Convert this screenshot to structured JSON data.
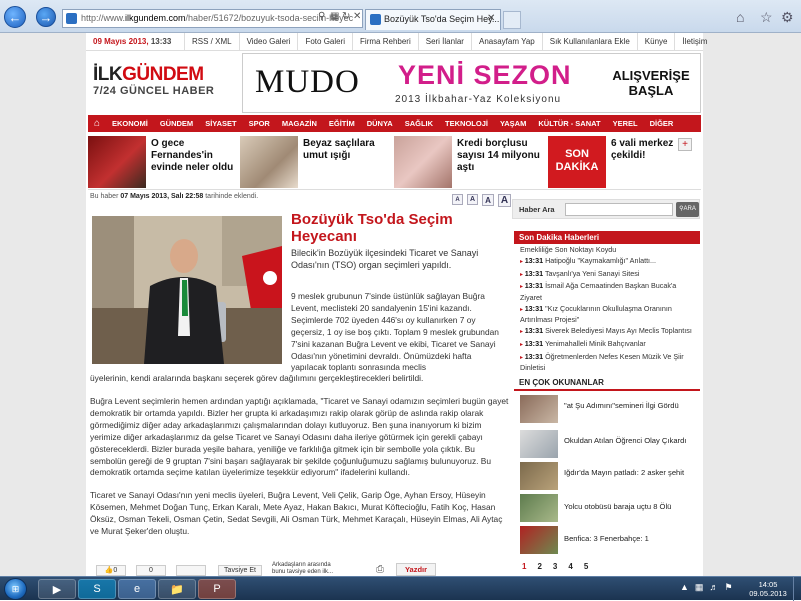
{
  "browser": {
    "url_prefix": "http://www.",
    "url_domain": "ilkgundem.com",
    "url_rest": "/haber/51672/bozuyuk-tsoda-secim-heyec",
    "tab_title": "Bozüyük Tso'da Seçim Hey...",
    "icons": {
      "back": "back-arrow-icon",
      "forward": "forward-arrow-icon",
      "home": "home-icon",
      "favorites": "star-icon",
      "tools": "gear-icon"
    }
  },
  "site": {
    "date": "09 Mayıs 2013,",
    "time": "13:33",
    "top_links": [
      "RSS / XML",
      "Video Galeri",
      "Foto Galeri",
      "Firma Rehberi",
      "Seri İlanlar",
      "Anasayfam Yap",
      "Sık Kullanılanlara Ekle",
      "Künye",
      "İletişim"
    ],
    "logo_part1": "İLK",
    "logo_part2": "GÜNDEM",
    "logo_tagline": "7/24 GÜNCEL HABER"
  },
  "banner": {
    "brand": "MUDO",
    "headline": "YENİ SEZON",
    "subline": "2013 İlkbahar-Yaz Koleksiyonu",
    "cta_line1": "ALIŞVERİŞE",
    "cta_line2": "BAŞLA"
  },
  "nav": [
    "EKONOMİ",
    "GÜNDEM",
    "SİYASET",
    "SPOR",
    "MAGAZİN",
    "EĞİTİM",
    "DÜNYA",
    "SAĞLIK",
    "TEKNOLOJİ",
    "YAŞAM",
    "KÜLTÜR - SANAT",
    "YEREL",
    "DİĞER"
  ],
  "teasers": [
    {
      "line1": "O gece",
      "line2": "Fernandes'in",
      "line3": "evinde neler oldu"
    },
    {
      "line1": "Beyaz saçlılara",
      "line2": "umut ışığı",
      "line3": ""
    },
    {
      "line1": "Kredi borçlusu",
      "line2": "sayısı 14 milyonu",
      "line3": "aştı"
    },
    {
      "line1": "6 vali merkez",
      "line2": "çekildi!",
      "line3": ""
    }
  ],
  "son_dakika_badge": {
    "line1": "SON",
    "line2": "DAKİKA"
  },
  "article": {
    "meta_prefix": "Bu haber",
    "meta_date": "07 Mayıs 2013, Salı 22:58",
    "meta_suffix": "tarihinde eklendi.",
    "font_buttons": [
      "A",
      "A",
      "A",
      "A"
    ],
    "title": "Bozüyük Tso'da Seçim Heyecanı",
    "lead": "Bilecik'in Bozüyük ilçesindeki Ticaret ve Sanayi Odası'nın (TSO) organ seçimleri yapıldı.",
    "p1a": "9 meslek grubunun 7'sinde üstünlük sağlayan Buğra Levent, meclisteki 20 sandalyenin 15'ini kazandı. Seçimlerde 702 üyeden 446'sı oy kullanırken 7 oy geçersiz, 1 oy ise boş çıktı. Toplam 9 meslek grubundan 7'sini kazanan Buğra Levent ve ekibi, Ticaret ve Sanayi Odası'nın yönetimini devraldı. Önümüzdeki hafta yapılacak toplantı sonrasında meclis",
    "p1b": "üyelerinin, kendi aralarında başkanı seçerek görev dağılımını gerçekleştirecekleri belirtildi.",
    "p2": "Buğra Levent seçimlerin hemen ardından yaptığı açıklamada, \"Ticaret ve Sanayi odamızın seçimleri bugün gayet demokratik bir ortamda yapıldı. Bizler her grupta ki arkadaşımızı rakip olarak görüp de aslında rakip olarak görmediğimiz diğer aday arkadaşlarımızı çalışmalarından dolayı kutluyoruz. Ben şuna inanıyorum ki bizim yerimize diğer arkadaşlarımız da gelse Ticaret ve Sanayi Odasını daha ileriye götürmek için gerekli çabayı göstereceklerdi. Bizler burada yeşile bahara, yeniliğe ve farklılığa gitmek için bir sembolle yola çıktık. Bu sembolün gereği de 9 gruptan 7'sini başarı sağlayarak bir şekilde çoğunluğumuzu sağlamış bulunuyoruz. Bu demokratik ortamda seçime katılan üyelerimize teşekkür ediyorum\" ifadelerini kullandı.",
    "p3": "Ticaret ve Sanayi Odası'nın yeni meclis üyeleri, Buğra Levent, Veli Çelik, Garip Öge, Ayhan Ersoy, Hüseyin Kösemen, Mehmet Doğan Tunç, Erkan Karalı, Mete Ayaz, Hakan Bakıcı, Murat Köftecioğlu, Fatih Koç, Hasan Öksüz, Osman Tekeli, Osman Çetin, Sedat Sevgili, Ali Osman Türk, Mehmet Karaçalı, Hüseyin Elmas, Ali Aytaç ve Murat Şeker'den oluştu.",
    "share_count1": "0",
    "share_count2": "0",
    "share_tweet": "Tavsiye Et",
    "share_friends1": "Arkadaşların arasında",
    "share_friends2": "bunu tavsiye eden ilk...",
    "print": "Yazdır"
  },
  "sidebar": {
    "search_label": "Haber Ara",
    "search_placeholder": "",
    "search_button": "ARA",
    "son_dakika_title": "Son Dakika Haberleri",
    "son_dakika_first": "Emekliliğe Son Noktayı Koydu",
    "son_dakika": [
      {
        "time": "13:31",
        "text": "Hatipoğlu \"Kaymakamlığı\" Anlattı..."
      },
      {
        "time": "13:31",
        "text": "Tavşanlı'ya Yeni Sanayi Sitesi"
      },
      {
        "time": "13:31",
        "text": "İsmail Ağa Cemaatinden Başkan Bucak'a Ziyaret"
      },
      {
        "time": "13:31",
        "text": "\"Kız Çocuklarının Okullulaşma Oranının Artırılması Projesi\""
      },
      {
        "time": "13:31",
        "text": "Siverek Belediyesi Mayıs Ayı Meclis Toplantısı"
      },
      {
        "time": "13:31",
        "text": "Yenimahalleli Minik Bahçıvanlar"
      },
      {
        "time": "13:31",
        "text": "Öğretmenlerden Nefes Kesen Müzik Ve Şiir Dinletisi"
      }
    ],
    "most_read_title": "EN ÇOK OKUNANLAR",
    "most_read": [
      {
        "text": "\"at Şu Adımını\"semineri İlgi Gördü"
      },
      {
        "text": "Okuldan Atılan Öğrenci Olay Çıkardı"
      },
      {
        "text": "Iğdır'da Mayın patladı: 2 asker şehit"
      },
      {
        "text": "Yolcu otobüsü baraja uçtu 8 Ölü"
      },
      {
        "text": "Benfica: 3 Fenerbahçe: 1"
      }
    ],
    "pages": [
      "1",
      "2",
      "3",
      "4",
      "5"
    ]
  },
  "taskbar": {
    "time": "14:05",
    "date": "09.05.2013"
  }
}
